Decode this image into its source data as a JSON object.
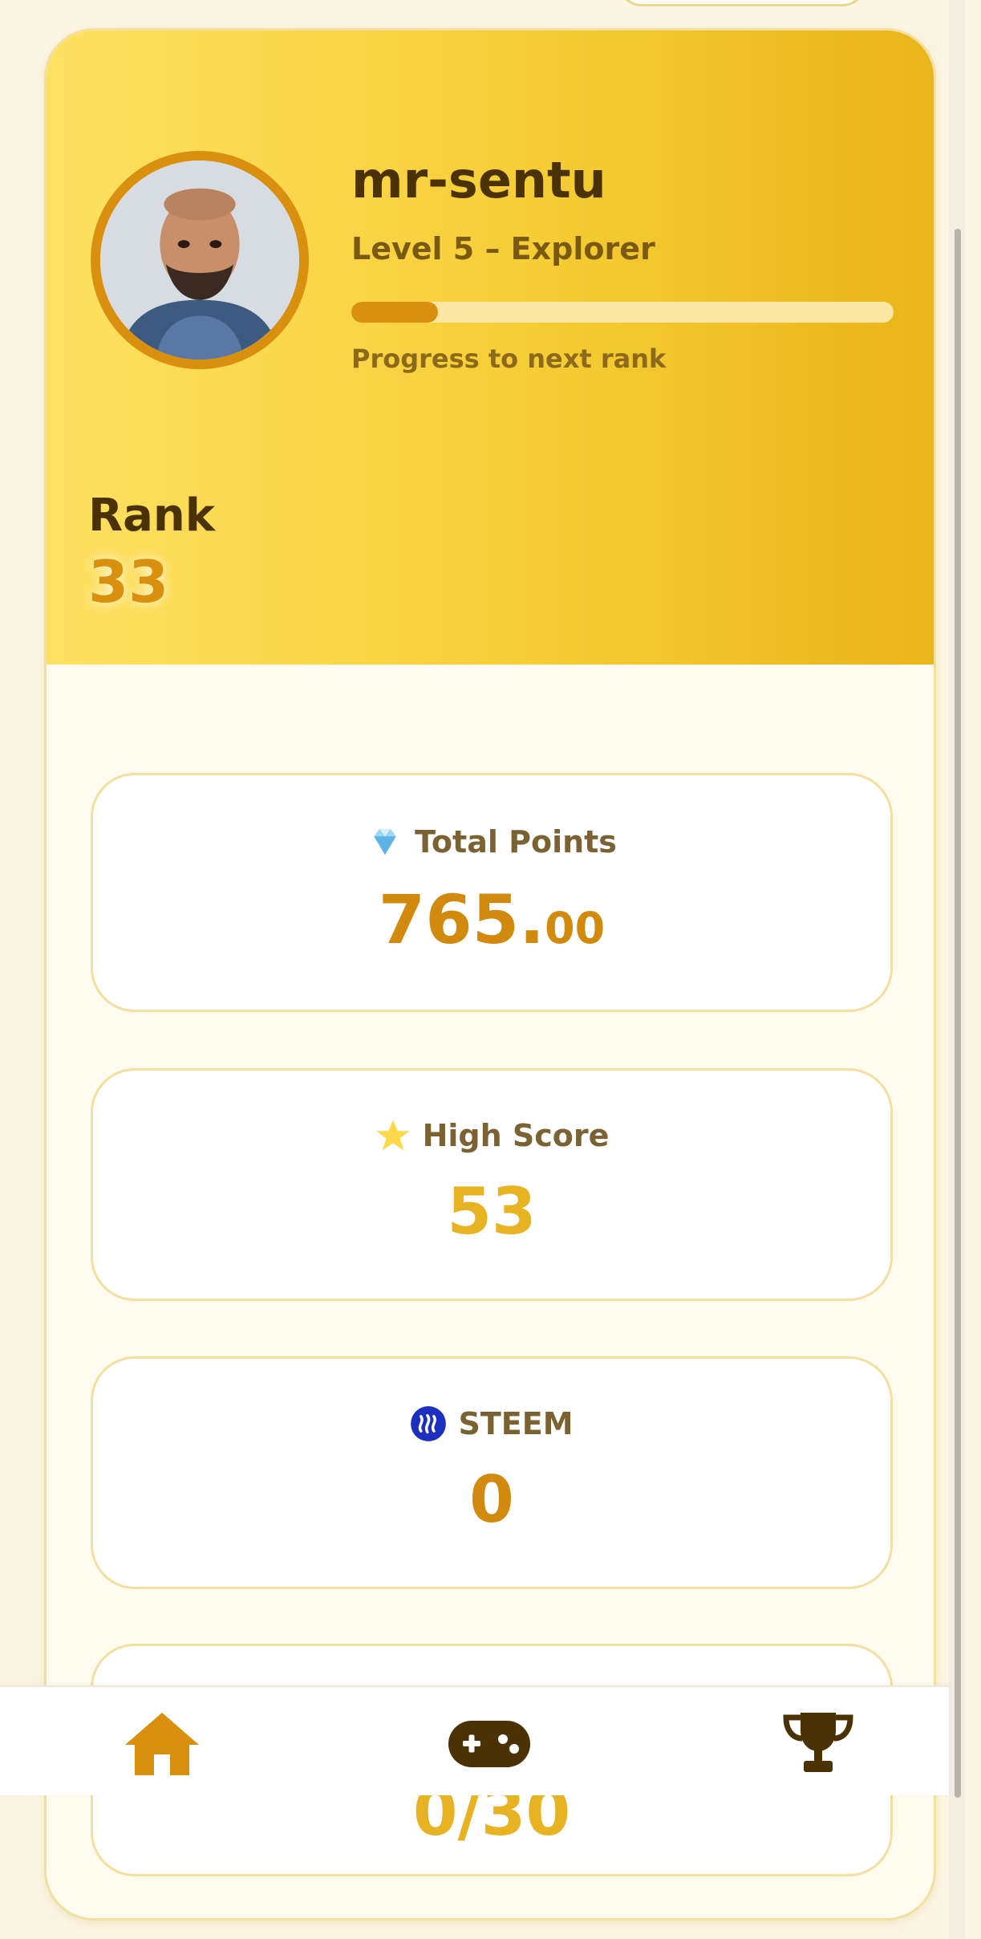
{
  "profile": {
    "username": "mr-sentu",
    "level": "Level 5 – Explorer",
    "progress_fraction": 0.16,
    "progress_label": "Progress to next rank",
    "rank_label": "Rank",
    "rank_value": "33",
    "avatar_icon": "user-photo"
  },
  "stats": {
    "total_points": {
      "icon": "gem-icon",
      "label": "Total Points",
      "value_int": "765.",
      "value_dec": "00"
    },
    "high_score": {
      "icon": "star-icon",
      "label": "High Score",
      "value": "53"
    },
    "steem": {
      "icon": "steem-logo-icon",
      "label": "STEEM",
      "value": "0"
    },
    "fourth": {
      "value": "0/30"
    }
  },
  "nav": {
    "items": [
      "home-icon",
      "gamepad-icon",
      "trophy-icon"
    ],
    "active": "home-icon"
  },
  "colors": {
    "accent": "#d9900f",
    "header_start": "#fee163",
    "header_end": "#e9b51b",
    "dark_text": "#4b3205",
    "steem_blue": "#1d2fbf"
  }
}
